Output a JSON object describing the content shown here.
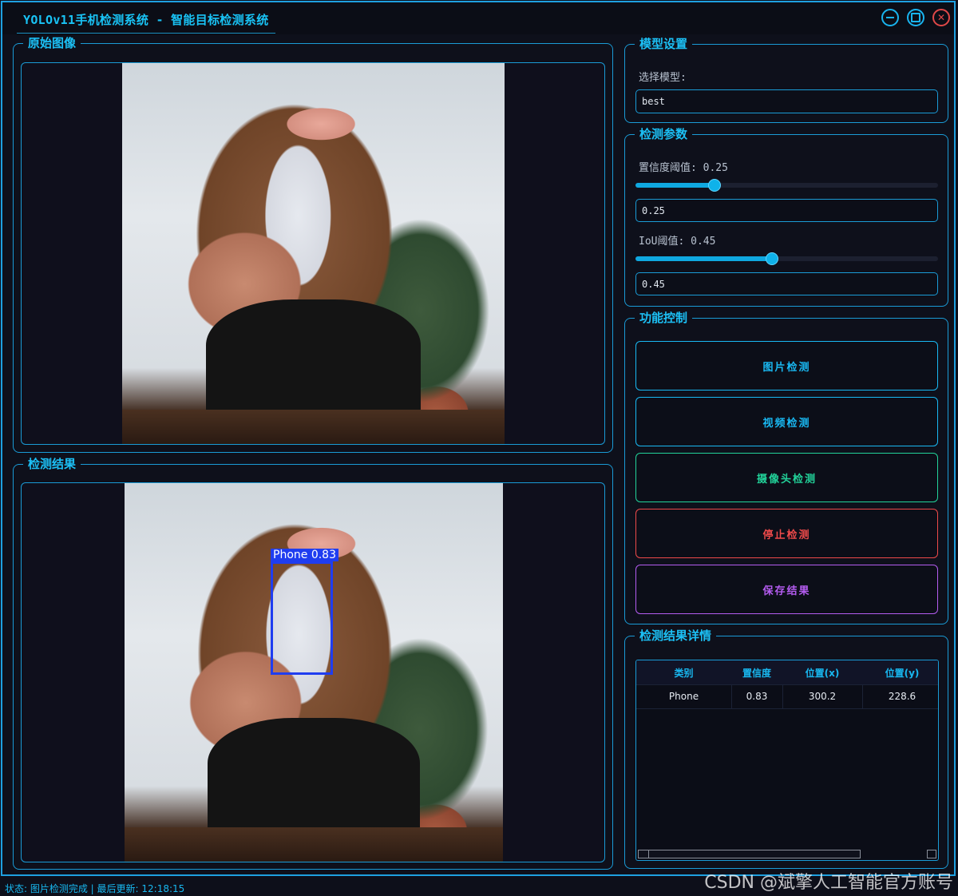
{
  "window": {
    "title": "YOLOv11手机检测系统 - 智能目标检测系统"
  },
  "panels": {
    "original": {
      "title": "原始图像"
    },
    "result": {
      "title": "检测结果",
      "detection": {
        "label": "Phone 0.83",
        "color": "#1f3df0"
      }
    }
  },
  "model_settings": {
    "title": "模型设置",
    "select_label": "选择模型:",
    "selected_model": "best"
  },
  "detect_params": {
    "title": "检测参数",
    "confidence": {
      "label": "置信度阈值: 0.25",
      "value": 0.25,
      "input": "0.25"
    },
    "iou": {
      "label": "IoU阈值: 0.45",
      "value": 0.45,
      "input": "0.45"
    }
  },
  "functions": {
    "title": "功能控制",
    "buttons": [
      {
        "label": "图片检测",
        "color": "#19b8f2"
      },
      {
        "label": "视频检测",
        "color": "#19b8f2"
      },
      {
        "label": "摄像头检测",
        "color": "#22d39a"
      },
      {
        "label": "停止检测",
        "color": "#ee4a4a"
      },
      {
        "label": "保存结果",
        "color": "#b45cf0"
      }
    ]
  },
  "details": {
    "title": "检测结果详情",
    "columns": [
      "类别",
      "置信度",
      "位置(x)",
      "位置(y)"
    ],
    "rows": [
      [
        "Phone",
        "0.83",
        "300.2",
        "228.6"
      ]
    ]
  },
  "status_bar": {
    "text": "状态: 图片检测完成 | 最后更新: 12:18:15"
  },
  "watermark": {
    "text": "CSDN @斌擎人工智能官方账号"
  },
  "colors": {
    "accent": "#1a9bd6",
    "title": "#19c3f5"
  }
}
